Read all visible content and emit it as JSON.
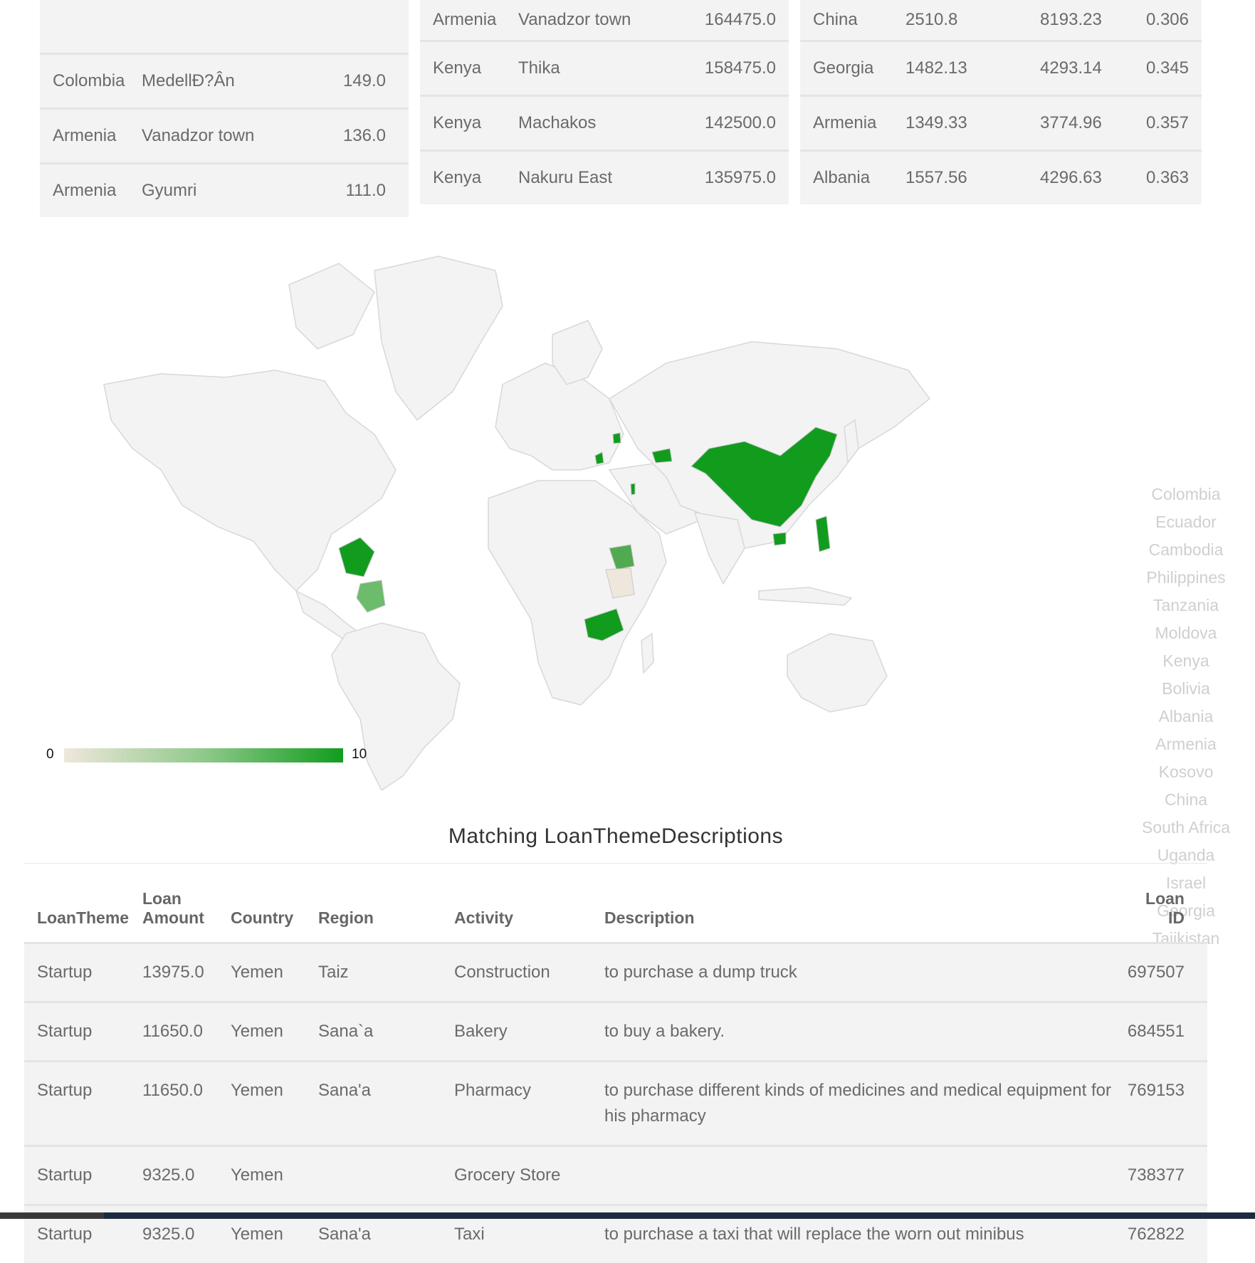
{
  "table_regions_count": {
    "rows": [
      {
        "country": "Colombia",
        "region": "MedellÐ?Ân",
        "value": "149.0"
      },
      {
        "country": "Armenia",
        "region": "Vanadzor town",
        "value": "136.0"
      },
      {
        "country": "Armenia",
        "region": "Gyumri",
        "value": "111.0"
      }
    ]
  },
  "table_regions_amount": {
    "rows": [
      {
        "country": "Armenia",
        "region": "Vanadzor town",
        "value": "164475.0"
      },
      {
        "country": "Kenya",
        "region": "Thika",
        "value": "158475.0"
      },
      {
        "country": "Kenya",
        "region": "Machakos",
        "value": "142500.0"
      },
      {
        "country": "Kenya",
        "region": "Nakuru East",
        "value": "135975.0"
      }
    ]
  },
  "table_countries_stats": {
    "rows": [
      {
        "country": "China",
        "a": "2510.8",
        "b": "8193.23",
        "c": "0.306"
      },
      {
        "country": "Georgia",
        "a": "1482.13",
        "b": "4293.14",
        "c": "0.345"
      },
      {
        "country": "Armenia",
        "a": "1349.33",
        "b": "3774.96",
        "c": "0.357"
      },
      {
        "country": "Albania",
        "a": "1557.56",
        "b": "4296.63",
        "c": "0.363"
      }
    ]
  },
  "map": {
    "scale_min": "0",
    "scale_max": "10",
    "colors": {
      "low": "#efe7dc",
      "mid": "#8fc98a",
      "high": "#129c1e",
      "land": "#f3f3f3",
      "border": "#d8d8d8"
    },
    "legend_countries": [
      "Colombia",
      "Ecuador",
      "Cambodia",
      "Philippines",
      "Tanzania",
      "Moldova",
      "Kenya",
      "Bolivia",
      "Albania",
      "Armenia",
      "Kosovo",
      "China",
      "South Africa",
      "Uganda",
      "Israel",
      "Georgia",
      "Tajikistan"
    ]
  },
  "loan_section": {
    "title": "Matching LoanThemeDescriptions",
    "headers": {
      "theme": "LoanTheme",
      "amount_line1": "Loan",
      "amount_line2": "Amount",
      "country": "Country",
      "region": "Region",
      "activity": "Activity",
      "description": "Description",
      "loan_id": "Loan ID"
    },
    "rows": [
      {
        "theme": "Startup",
        "amount": "13975.0",
        "country": "Yemen",
        "region": "Taiz",
        "activity": "Construction",
        "description": "to purchase a dump truck",
        "loan_id": "697507"
      },
      {
        "theme": "Startup",
        "amount": "11650.0",
        "country": "Yemen",
        "region": "Sana`a",
        "activity": "Bakery",
        "description": "to buy a bakery.",
        "loan_id": "684551"
      },
      {
        "theme": "Startup",
        "amount": "11650.0",
        "country": "Yemen",
        "region": "Sana'a",
        "activity": "Pharmacy",
        "description": "to purchase different kinds of medicines and medical equipment for his pharmacy",
        "loan_id": "769153"
      },
      {
        "theme": "Startup",
        "amount": "9325.0",
        "country": "Yemen",
        "region": "",
        "activity": "Grocery Store",
        "description": "",
        "loan_id": "738377"
      },
      {
        "theme": "Startup",
        "amount": "9325.0",
        "country": "Yemen",
        "region": "Sana'a",
        "activity": "Taxi",
        "description": "to purchase a taxi that will replace the worn out minibus",
        "loan_id": "762822"
      }
    ]
  }
}
